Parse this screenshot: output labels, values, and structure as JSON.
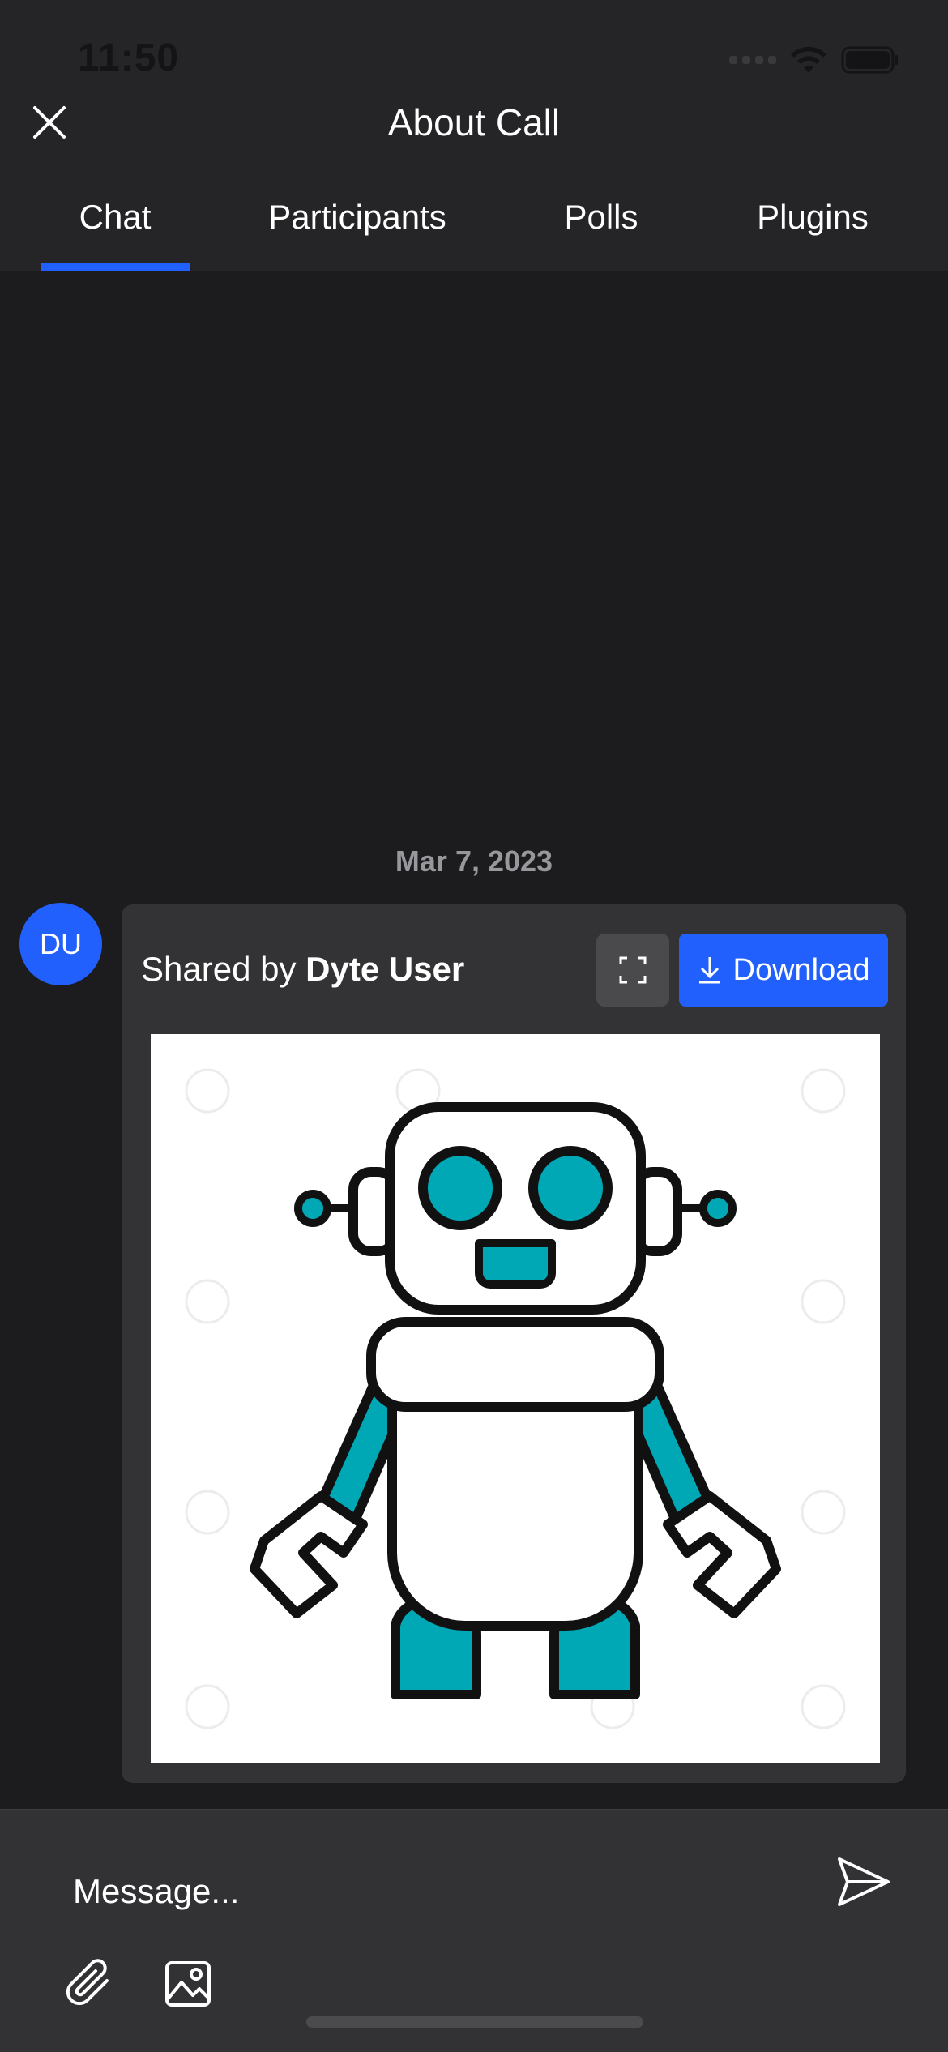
{
  "status_bar": {
    "time": "11:50"
  },
  "header": {
    "title": "About Call",
    "close_icon": "close-icon"
  },
  "tabs": [
    {
      "label": "Chat",
      "active": true
    },
    {
      "label": "Participants",
      "active": false
    },
    {
      "label": "Polls",
      "active": false
    },
    {
      "label": "Plugins",
      "active": false
    }
  ],
  "chat": {
    "date_separator": "Mar 7, 2023",
    "messages": [
      {
        "avatar_initials": "DU",
        "shared_by_prefix": "Shared by",
        "sender": "Dyte User",
        "download_label": "Download",
        "image_icon": "robot-image"
      }
    ]
  },
  "composer": {
    "placeholder": "Message..."
  },
  "colors": {
    "accent": "#2160fd",
    "background": "#1c1c1e",
    "header": "#252527",
    "card": "#333335",
    "robot_teal": "#00a8b5"
  }
}
